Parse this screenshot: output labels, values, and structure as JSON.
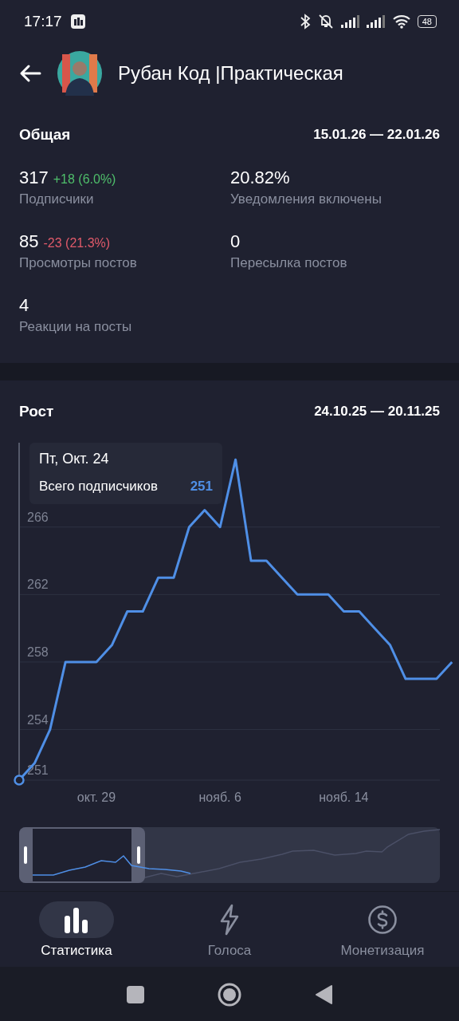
{
  "status_bar": {
    "time": "17:17",
    "battery": "48"
  },
  "header": {
    "title": "Рубан Код |Практическая"
  },
  "overview": {
    "title": "Общая",
    "range": "15.01.26 — 22.01.26",
    "stats": [
      {
        "value": "317",
        "delta": "+18 (6.0%)",
        "color": "#4fbf6b",
        "label": "Подписчики"
      },
      {
        "value": "20.82%",
        "label": "Уведомления включены"
      },
      {
        "value": "85",
        "delta": "-23 (21.3%)",
        "color": "#e05a6a",
        "label": "Просмотры постов"
      },
      {
        "value": "0",
        "label": "Пересылка постов"
      },
      {
        "value": "4",
        "label": "Реакции на посты"
      }
    ]
  },
  "growth": {
    "title": "Рост",
    "range": "24.10.25 — 20.11.25",
    "tooltip": {
      "date": "Пт, Окт. 24",
      "label": "Всего подписчиков",
      "value": "251"
    },
    "chart_data": {
      "type": "line",
      "categories": [
        null,
        null,
        null,
        null,
        null,
        "окт. 29",
        null,
        null,
        null,
        null,
        null,
        null,
        null,
        "нояб. 6",
        null,
        null,
        null,
        null,
        null,
        null,
        null,
        "нояб. 14",
        null,
        null,
        null,
        null,
        null,
        null,
        null
      ],
      "series": [
        {
          "color": "#4f8fe6",
          "values": [
            251,
            252,
            254,
            258,
            258,
            258,
            259,
            261,
            261,
            263,
            263,
            266,
            267,
            266,
            270,
            264,
            264,
            263,
            262,
            262,
            262,
            261,
            261,
            260,
            259,
            257,
            257,
            257,
            258
          ]
        }
      ],
      "ylim": [
        251,
        271
      ],
      "grid": true,
      "yticks": [
        251,
        254,
        258,
        262,
        266
      ]
    }
  },
  "bottom_nav": [
    {
      "label": "Статистика",
      "selected": true
    },
    {
      "label": "Голоса",
      "selected": false
    },
    {
      "label": "Монетизация",
      "selected": false
    }
  ]
}
